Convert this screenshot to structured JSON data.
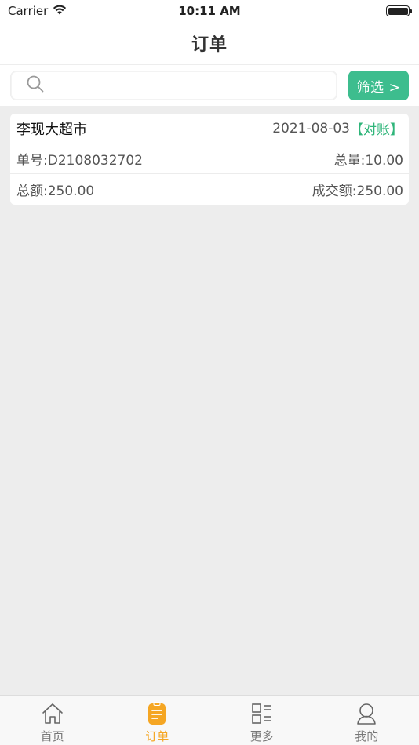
{
  "status_bar": {
    "carrier": "Carrier",
    "time": "10:11 AM"
  },
  "nav": {
    "title": "订单"
  },
  "search": {
    "placeholder": "",
    "value": "",
    "filter_label": "筛选 >"
  },
  "orders": [
    {
      "shop_name": "李现大超市",
      "date": "2021-08-03",
      "tag": "【对账】",
      "order_no": "单号:D2108032702",
      "total_qty": "总量:10.00",
      "total_amount": "总额:250.00",
      "deal_amount": "成交额:250.00"
    }
  ],
  "tabs": [
    {
      "label": "首页",
      "icon": "home-icon",
      "active": false
    },
    {
      "label": "订单",
      "icon": "order-icon",
      "active": true
    },
    {
      "label": "更多",
      "icon": "grid-list-icon",
      "active": false
    },
    {
      "label": "我的",
      "icon": "user-icon",
      "active": false
    }
  ],
  "colors": {
    "accent_green": "#3dbd8e",
    "tag_green": "#2fb57a",
    "tab_active": "#f5a623",
    "background": "#ededed"
  }
}
